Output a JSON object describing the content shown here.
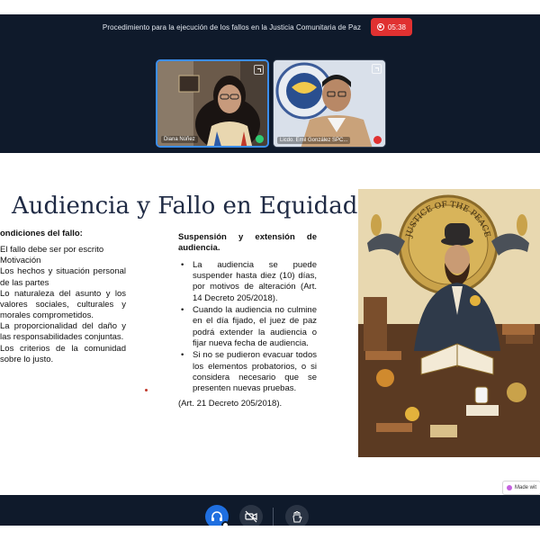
{
  "meeting": {
    "title": "Procedimiento para la ejecución de los fallos en la Justicia Comunitaria de Paz",
    "recording_time": "05:38",
    "participants": [
      {
        "name": "Diana Núñez",
        "status": "speaking"
      },
      {
        "name": "Licdo. Emil González SPC...",
        "status": "muted"
      }
    ]
  },
  "slide": {
    "title": "Audiencia y Fallo en Equidad",
    "left": {
      "heading": "ondiciones del fallo:",
      "items": [
        "El fallo debe ser por escrito",
        "Motivación",
        "Los hechos y situación personal de las partes",
        "Lo naturaleza del asunto y los valores sociales, culturales y morales comprometidos.",
        "La proporcionalidad del daño y las responsabilidades conjuntas.",
        "Los criterios de la comunidad sobre lo justo."
      ]
    },
    "right": {
      "heading": "Suspensión y extensión de audiencia.",
      "items": [
        "La audiencia se puede suspender hasta diez (10) días, por motivos de alteración (Art. 14 Decreto 205/2018).",
        "Cuando la audiencia no culmine en el día fijado, el juez de paz podrá extender la audiencia o fijar nueva fecha de audiencia.",
        "Si no se pudieron evacuar todos los elementos probatorios, o si considera necesario que se presenten nuevas pruebas."
      ],
      "citation": "(Art. 21 Decreto 205/2018)."
    },
    "art_text": "JUSTICE OF THE PEACE",
    "made_with": "Made wit"
  },
  "controls": {
    "icons": [
      "headset-icon",
      "camera-off-icon",
      "raise-hand-icon"
    ]
  },
  "colors": {
    "meeting_bg": "#0f1a2b",
    "record_red": "#e03131",
    "active_blue": "#1f6fe0",
    "title_navy": "#1f2a44"
  }
}
